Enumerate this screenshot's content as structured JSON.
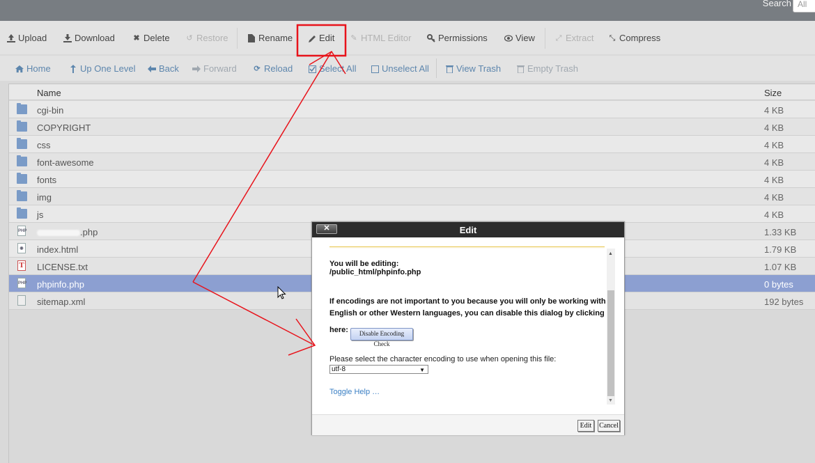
{
  "topbar": {
    "search_label": "Search",
    "search_value": "All"
  },
  "toolbar": {
    "upload": "Upload",
    "download": "Download",
    "delete": "Delete",
    "restore": "Restore",
    "rename": "Rename",
    "edit": "Edit",
    "html_editor": "HTML Editor",
    "permissions": "Permissions",
    "view": "View",
    "extract": "Extract",
    "compress": "Compress"
  },
  "nav": {
    "home": "Home",
    "up_one_level": "Up One Level",
    "back": "Back",
    "forward": "Forward",
    "reload": "Reload",
    "select_all": "Select All",
    "unselect_all": "Unselect All",
    "view_trash": "View Trash",
    "empty_trash": "Empty Trash"
  },
  "table": {
    "headers": {
      "name": "Name",
      "size": "Size"
    },
    "rows": [
      {
        "name": "cgi-bin",
        "size": "4 KB",
        "type": "folder"
      },
      {
        "name": "COPYRIGHT",
        "size": "4 KB",
        "type": "folder"
      },
      {
        "name": "css",
        "size": "4 KB",
        "type": "folder"
      },
      {
        "name": "font-awesome",
        "size": "4 KB",
        "type": "folder"
      },
      {
        "name": "fonts",
        "size": "4 KB",
        "type": "folder"
      },
      {
        "name": "img",
        "size": "4 KB",
        "type": "folder"
      },
      {
        "name": "js",
        "size": "4 KB",
        "type": "folder"
      },
      {
        "name": ".php",
        "size": "1.33 KB",
        "type": "php"
      },
      {
        "name": "index.html",
        "size": "1.79 KB",
        "type": "html"
      },
      {
        "name": "LICENSE.txt",
        "size": "1.07 KB",
        "type": "txt"
      },
      {
        "name": "phpinfo.php",
        "size": "0 bytes",
        "type": "php",
        "selected": true
      },
      {
        "name": "sitemap.xml",
        "size": "192 bytes",
        "type": "xml"
      }
    ]
  },
  "dialog": {
    "title": "Edit",
    "close": "✕",
    "editing_label": "You will be editing:",
    "editing_path": "/public_html/phpinfo.php",
    "encodings_line1": "If encodings are not important to you because you will only be working with",
    "encodings_line2": "English or other Western languages, you can disable this dialog by clicking",
    "encodings_line3": "here:",
    "disable_button": "Disable Encoding Check",
    "select_prompt": "Please select the character encoding to use when opening this file:",
    "encoding_value": "utf-8",
    "toggle_help": "Toggle Help …",
    "edit_button": "Edit",
    "cancel_button": "Cancel"
  },
  "colors": {
    "annotation": "#e8131b",
    "selected_row": "#8c9fd1",
    "link": "#5d86ad",
    "topbar": "#787d82",
    "dialog_header": "#2c2c2c"
  }
}
